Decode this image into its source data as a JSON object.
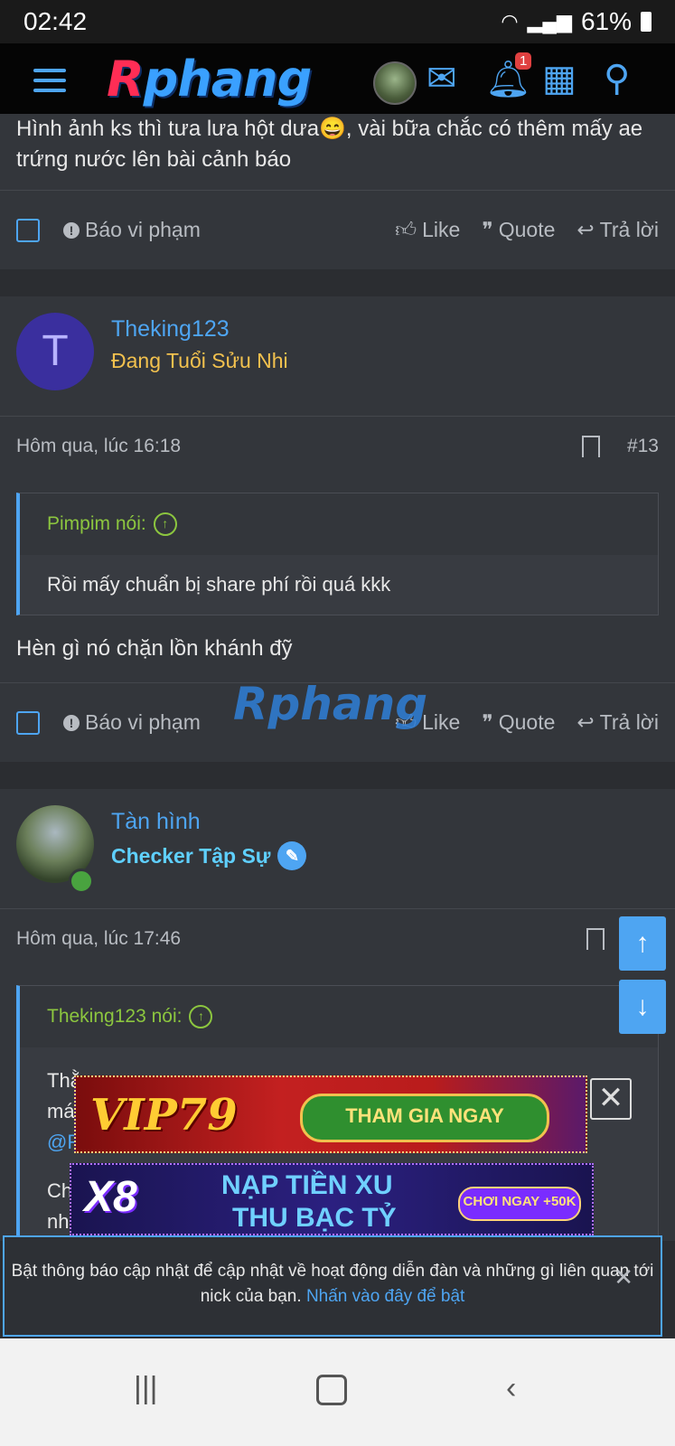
{
  "status": {
    "time": "02:42",
    "battery": "61%"
  },
  "nav": {
    "logo_r": "R",
    "logo_rest": "phang",
    "notif_count": "1"
  },
  "post12": {
    "text": "Hình ảnh ks thì tưa lưa hột dưa😄, vài bữa chắc có thêm mấy ae trứng nước lên bài cảnh báo"
  },
  "actions": {
    "report": "Báo vi phạm",
    "like": "Like",
    "quote": "Quote",
    "reply": "Trả lời"
  },
  "post13": {
    "username": "Theking123",
    "avatar_letter": "T",
    "user_title": "Đang Tuổi Sửu Nhi",
    "time": "Hôm qua, lúc 16:18",
    "number": "#13",
    "quote_author": "Pimpim nói:",
    "quote_text": "Rồi mấy chuẩn bị share phí rồi quá kkk",
    "text": "Hèn gì nó chặn lồn khánh đỹ"
  },
  "post14": {
    "username": "Tàn hình",
    "user_title": "Checker Tập Sự",
    "time": "Hôm qua, lúc 17:46",
    "quote_author": "Theking123 nói:",
    "quote_line1": "Thằ",
    "quote_line2": "má",
    "quote_line3": "@R",
    "quote_line4": "Ch",
    "quote_line5": "nh"
  },
  "watermark": "Rphang",
  "ads": {
    "vip_brand": "VIP79",
    "vip_cta": "THAM GIA NGAY",
    "x8_brand": "X8",
    "x8_line1": "NẠP TIỀN XU",
    "x8_line2": "THU BẠC TỶ",
    "x8_cta": "CHƠI NGAY +50K"
  },
  "notice": {
    "text": "Bật thông báo cập nhật để cập nhật về hoạt động diễn đàn và những gì liên quan tới nick của bạn.",
    "link": "Nhấn vào đây để bật"
  }
}
